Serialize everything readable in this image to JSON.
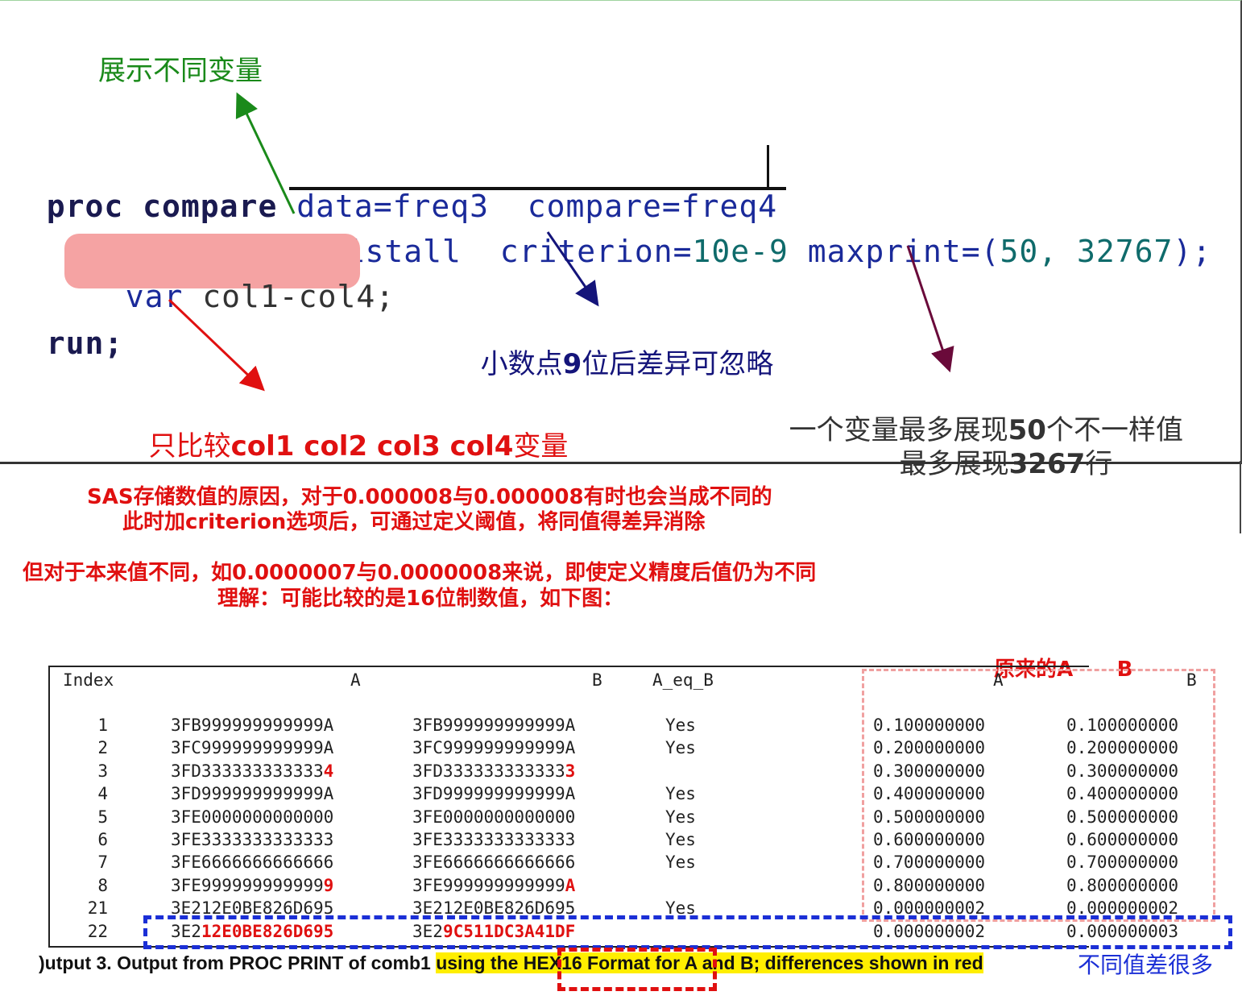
{
  "code": {
    "proc": "proc",
    "compare": "compare",
    "data_opt": "data=freq3",
    "compare_opt": "compare=freq4",
    "listall": "listall",
    "criterion_key": "criterion=",
    "criterion_val": "10e-9",
    "maxprint_key": "maxprint=(",
    "maxprint_val": "50, 32767",
    "maxprint_end": ");",
    "var_kw": "var",
    "var_list": "col1-col4;",
    "run": "run;"
  },
  "annotations": {
    "show_diff_vars": "展示不同变量",
    "criterion_note_pre": "小数点",
    "criterion_note_num": "9",
    "criterion_note_post": "位后差异可忽略",
    "var_note_pre": "只比较",
    "var_note_cols": "col1 col2 col3 col4",
    "var_note_post": "变量",
    "maxprint_note1_pre": "一个变量最多展现",
    "maxprint_note1_num": "50",
    "maxprint_note1_post": "个不一样值",
    "maxprint_note2_pre": "最多展现",
    "maxprint_note2_num": "3267",
    "maxprint_note2_post": "行"
  },
  "explanation": {
    "line1": "SAS存储数值的原因，对于0.000008与0.000008有时也会当成不同的",
    "line2": "此时加criterion选项后，可通过定义阈值，将同值得差异消除",
    "line3": "但对于本来值不同，如0.0000007与0.0000008来说，即使定义精度后值仍为不同",
    "line4": "理解：可能比较的是16位制数值，如下图："
  },
  "orig_label": {
    "pre": "原来的",
    "a": "A",
    "b": "B"
  },
  "table": {
    "headers": {
      "index": "Index",
      "a": "A",
      "b": "B",
      "aeqb": "A_eq_B",
      "a2": "A",
      "b2": "B"
    },
    "rows": [
      {
        "index": "1",
        "a_base": "3FB999999999999A",
        "a_hl": "",
        "b_base": "3FB999999999999A",
        "b_hl": "",
        "eq": "Yes",
        "av": "0.100000000",
        "bv": "0.100000000"
      },
      {
        "index": "2",
        "a_base": "3FC999999999999A",
        "a_hl": "",
        "b_base": "3FC999999999999A",
        "b_hl": "",
        "eq": "Yes",
        "av": "0.200000000",
        "bv": "0.200000000"
      },
      {
        "index": "3",
        "a_base": "3FD333333333333",
        "a_hl": "4",
        "b_base": "3FD333333333333",
        "b_hl": "3",
        "eq": "",
        "av": "0.300000000",
        "bv": "0.300000000"
      },
      {
        "index": "4",
        "a_base": "3FD999999999999A",
        "a_hl": "",
        "b_base": "3FD999999999999A",
        "b_hl": "",
        "eq": "Yes",
        "av": "0.400000000",
        "bv": "0.400000000"
      },
      {
        "index": "5",
        "a_base": "3FE0000000000000",
        "a_hl": "",
        "b_base": "3FE0000000000000",
        "b_hl": "",
        "eq": "Yes",
        "av": "0.500000000",
        "bv": "0.500000000"
      },
      {
        "index": "6",
        "a_base": "3FE3333333333333",
        "a_hl": "",
        "b_base": "3FE3333333333333",
        "b_hl": "",
        "eq": "Yes",
        "av": "0.600000000",
        "bv": "0.600000000"
      },
      {
        "index": "7",
        "a_base": "3FE6666666666666",
        "a_hl": "",
        "b_base": "3FE6666666666666",
        "b_hl": "",
        "eq": "Yes",
        "av": "0.700000000",
        "bv": "0.700000000"
      },
      {
        "index": "8",
        "a_base": "3FE999999999999",
        "a_hl": "9",
        "b_base": "3FE999999999999",
        "b_hl": "A",
        "eq": "",
        "av": "0.800000000",
        "bv": "0.800000000"
      },
      {
        "index": "21",
        "a_base": "3E212E0BE826D695",
        "a_hl": "",
        "b_base": "3E212E0BE826D695",
        "b_hl": "",
        "eq": "Yes",
        "av": "0.000000002",
        "bv": "0.000000002"
      },
      {
        "index": "22",
        "a_base": "3E2",
        "a_hl": "12E0BE826D695",
        "b_base": "3E2",
        "b_hl": "9C511DC3A41DF",
        "eq": "",
        "av": "0.000000002",
        "bv": "0.000000003"
      }
    ]
  },
  "caption": {
    "prefix": ")utput 3. Output from PROC PRINT of comb1 ",
    "highlighted": "using the HEX16 Format for A and B; differences shown in red",
    "cn_note": "不同值差很多"
  },
  "colors": {
    "green_arrow": "#1a8a1a",
    "navy_arrow": "#14147a",
    "purple_arrow": "#6a0a3a",
    "red_arrow": "#e01010",
    "blue_box": "#1b2fd6"
  }
}
